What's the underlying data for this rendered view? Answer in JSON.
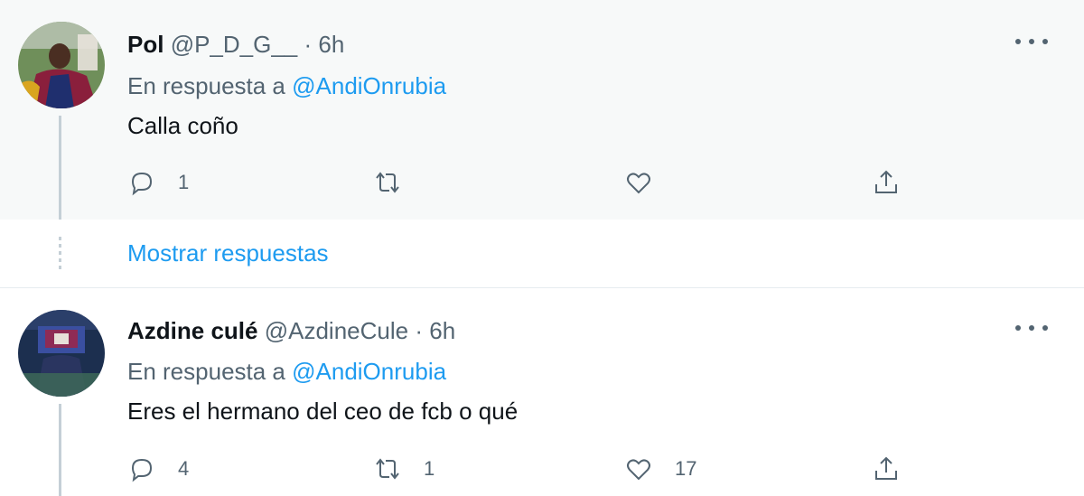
{
  "tweets": [
    {
      "name": "Pol",
      "handle": "@P_D_G__",
      "separator": "·",
      "time": "6h",
      "reply_prefix": "En respuesta a",
      "reply_to": "@AndiOnrubia",
      "text": "Calla coño",
      "counts": {
        "replies": "1",
        "retweets": "",
        "likes": ""
      }
    },
    {
      "name": "Azdine culé",
      "handle": "@AzdineCule",
      "separator": "·",
      "time": "6h",
      "reply_prefix": "En respuesta a",
      "reply_to": "@AndiOnrubia",
      "text": "Eres el hermano del ceo de fcb o qué",
      "counts": {
        "replies": "4",
        "retweets": "1",
        "likes": "17"
      }
    }
  ],
  "show_replies": {
    "label": "Mostrar respuestas"
  },
  "colors": {
    "accent": "#1d9bf0",
    "secondary_text": "#536471",
    "hover_background": "#f7f9f9"
  }
}
